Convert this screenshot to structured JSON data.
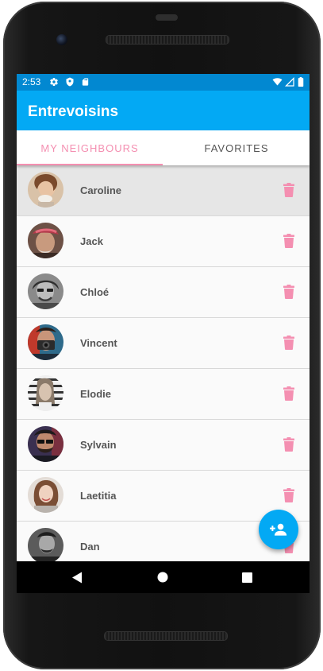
{
  "status_bar": {
    "time": "2:53",
    "left_icons": [
      "gear-icon",
      "shield-icon",
      "sd-card-icon"
    ],
    "right_icons": [
      "wifi-icon",
      "signal-icon",
      "battery-icon"
    ]
  },
  "app_bar": {
    "title": "Entrevoisins"
  },
  "tabs": [
    {
      "label": "MY NEIGHBOURS",
      "active": true
    },
    {
      "label": "FAVORITES",
      "active": false
    }
  ],
  "neighbours": [
    {
      "name": "Caroline",
      "selected": true
    },
    {
      "name": "Jack"
    },
    {
      "name": "Chloé"
    },
    {
      "name": "Vincent"
    },
    {
      "name": "Elodie"
    },
    {
      "name": "Sylvain"
    },
    {
      "name": "Laetitia"
    },
    {
      "name": "Dan"
    }
  ],
  "fab": {
    "icon": "add-person-icon"
  },
  "nav_bar": {
    "icons": [
      "back-icon",
      "home-icon",
      "recents-icon"
    ]
  },
  "colors": {
    "primary": "#03a9f4",
    "primary_dark": "#0288d1",
    "accent": "#f48fb1"
  }
}
